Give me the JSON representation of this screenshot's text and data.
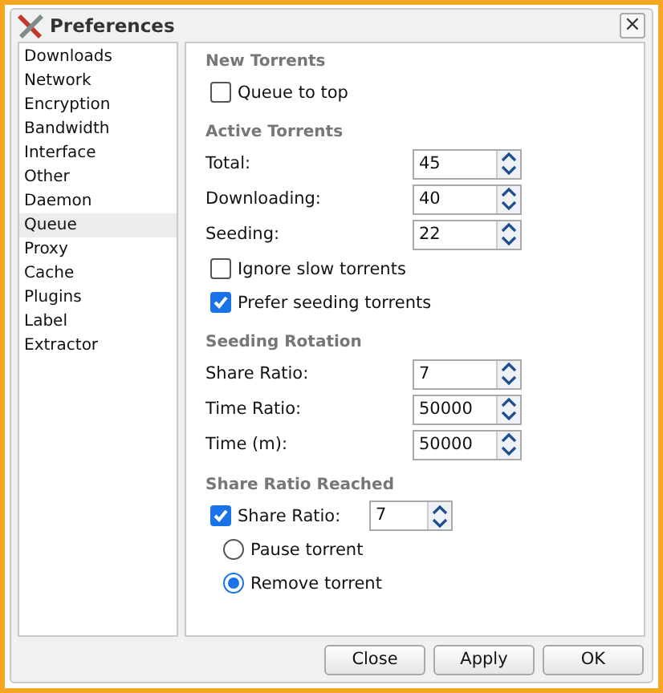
{
  "window": {
    "title": "Preferences",
    "close": "×"
  },
  "sidebar": {
    "items": [
      {
        "label": "Downloads",
        "selected": false
      },
      {
        "label": "Network",
        "selected": false
      },
      {
        "label": "Encryption",
        "selected": false
      },
      {
        "label": "Bandwidth",
        "selected": false
      },
      {
        "label": "Interface",
        "selected": false
      },
      {
        "label": "Other",
        "selected": false
      },
      {
        "label": "Daemon",
        "selected": false
      },
      {
        "label": "Queue",
        "selected": true
      },
      {
        "label": "Proxy",
        "selected": false
      },
      {
        "label": "Cache",
        "selected": false
      },
      {
        "label": "Plugins",
        "selected": false
      },
      {
        "label": "Label",
        "selected": false
      },
      {
        "label": "Extractor",
        "selected": false
      }
    ]
  },
  "sections": [
    {
      "title": "New Torrents",
      "items": [
        {
          "kind": "checkbox",
          "label": "Queue to top",
          "checked": false
        }
      ]
    },
    {
      "title": "Active Torrents",
      "items": [
        {
          "kind": "spinner",
          "label": "Total:",
          "value": "45"
        },
        {
          "kind": "spinner",
          "label": "Downloading:",
          "value": "40"
        },
        {
          "kind": "spinner",
          "label": "Seeding:",
          "value": "22"
        },
        {
          "kind": "checkbox",
          "label": "Ignore slow torrents",
          "checked": false
        },
        {
          "kind": "checkbox",
          "label": "Prefer seeding torrents",
          "checked": true
        }
      ]
    },
    {
      "title": "Seeding Rotation",
      "items": [
        {
          "kind": "spinner",
          "label": "Share Ratio:",
          "value": "7"
        },
        {
          "kind": "spinner",
          "label": "Time Ratio:",
          "value": "50000"
        },
        {
          "kind": "spinner",
          "label": "Time (m):",
          "value": "50000"
        }
      ]
    },
    {
      "title": "Share Ratio Reached",
      "items": [
        {
          "kind": "checkspinner",
          "label": "Share Ratio:",
          "checked": true,
          "value": "7"
        },
        {
          "kind": "radio",
          "label": "Pause torrent",
          "selected": false
        },
        {
          "kind": "radio",
          "label": "Remove torrent",
          "selected": true
        }
      ]
    }
  ],
  "buttons": [
    "Close",
    "Apply",
    "OK"
  ]
}
